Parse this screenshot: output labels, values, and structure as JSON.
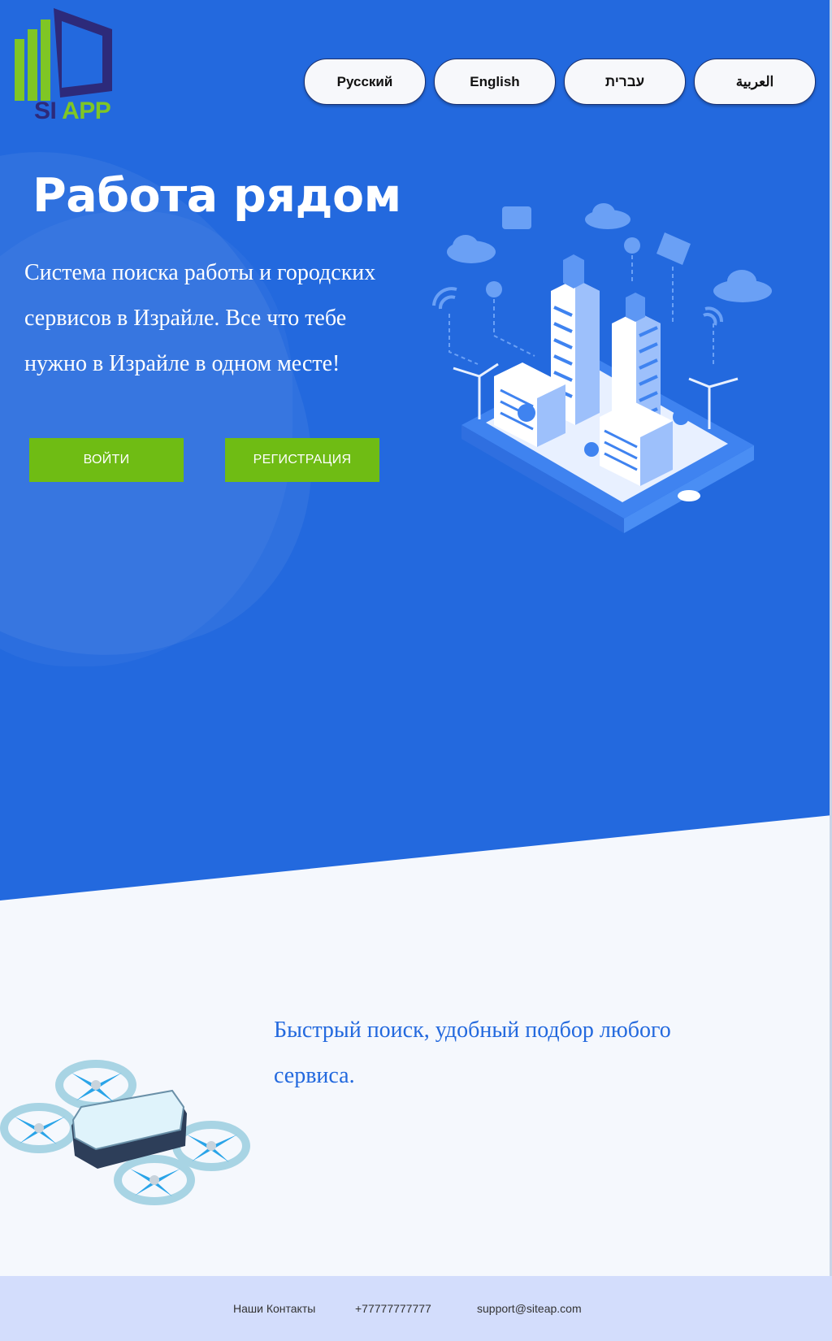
{
  "logo": {
    "text_si": "SI",
    "text_app": "APP"
  },
  "languages": [
    "Русский",
    "English",
    "עברית",
    "العربية"
  ],
  "hero": {
    "title": "Работа рядом",
    "subtitle": "Система поиска работы и городских сервисов в Израйле. Все что тебе нужно в Израйле в одном месте!",
    "login_label": "ВОЙТИ",
    "register_label": "РЕГИСТРАЦИЯ",
    "illustration_icon": "smart-city-illustration"
  },
  "feature": {
    "text": "Быстрый поиск, удобный подбор любого сервиса.",
    "illustration_icon": "drone-illustration"
  },
  "footer": {
    "contacts_label": "Наши Контакты",
    "phone": "+77777777777",
    "email": "support@siteap.com"
  },
  "colors": {
    "hero_bg": "#2369de",
    "accent_green": "#6fbc14",
    "footer_bg": "#d3ddfc",
    "feature_text": "#2369de"
  }
}
